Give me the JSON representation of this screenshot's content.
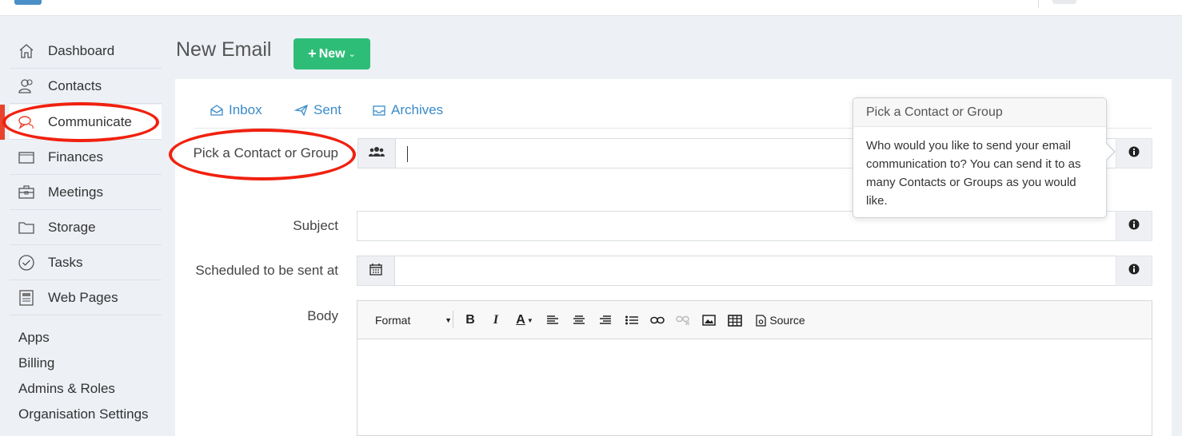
{
  "sidebar": {
    "items": [
      {
        "label": "Dashboard",
        "icon": "home-icon"
      },
      {
        "label": "Contacts",
        "icon": "contacts-icon"
      },
      {
        "label": "Communicate",
        "icon": "chat-icon"
      },
      {
        "label": "Finances",
        "icon": "wallet-icon"
      },
      {
        "label": "Meetings",
        "icon": "briefcase-icon"
      },
      {
        "label": "Storage",
        "icon": "folder-icon"
      },
      {
        "label": "Tasks",
        "icon": "check-circle-icon"
      },
      {
        "label": "Web Pages",
        "icon": "webpage-icon"
      }
    ],
    "links": [
      "Apps",
      "Billing",
      "Admins & Roles",
      "Organisation Settings"
    ],
    "active_color": "#e8432d"
  },
  "header": {
    "title": "New Email",
    "new_button": "New",
    "new_button_color": "#2ebd77"
  },
  "tabs": [
    {
      "label": "Inbox",
      "icon": "inbox-icon"
    },
    {
      "label": "Sent",
      "icon": "paper-plane-icon"
    },
    {
      "label": "Archives",
      "icon": "archive-icon"
    }
  ],
  "form": {
    "recipient_label": "Pick a Contact or Group",
    "recipient_value": "",
    "subject_label": "Subject",
    "subject_value": "",
    "schedule_label": "Scheduled to be sent at",
    "schedule_value": "",
    "body_label": "Body"
  },
  "popover": {
    "title": "Pick a Contact or Group",
    "body": "Who would you like to send your email communication to? You can send it to as many Contacts or Groups as you would like."
  },
  "editor": {
    "format_label": "Format",
    "source_label": "Source",
    "tools": [
      "bold-icon",
      "italic-icon",
      "text-color-icon",
      "align-left-icon",
      "align-center-icon",
      "align-right-icon",
      "bullet-list-icon",
      "link-icon",
      "unlink-icon",
      "image-icon",
      "table-icon",
      "source-icon"
    ]
  },
  "annotation_color": "#f0210f"
}
